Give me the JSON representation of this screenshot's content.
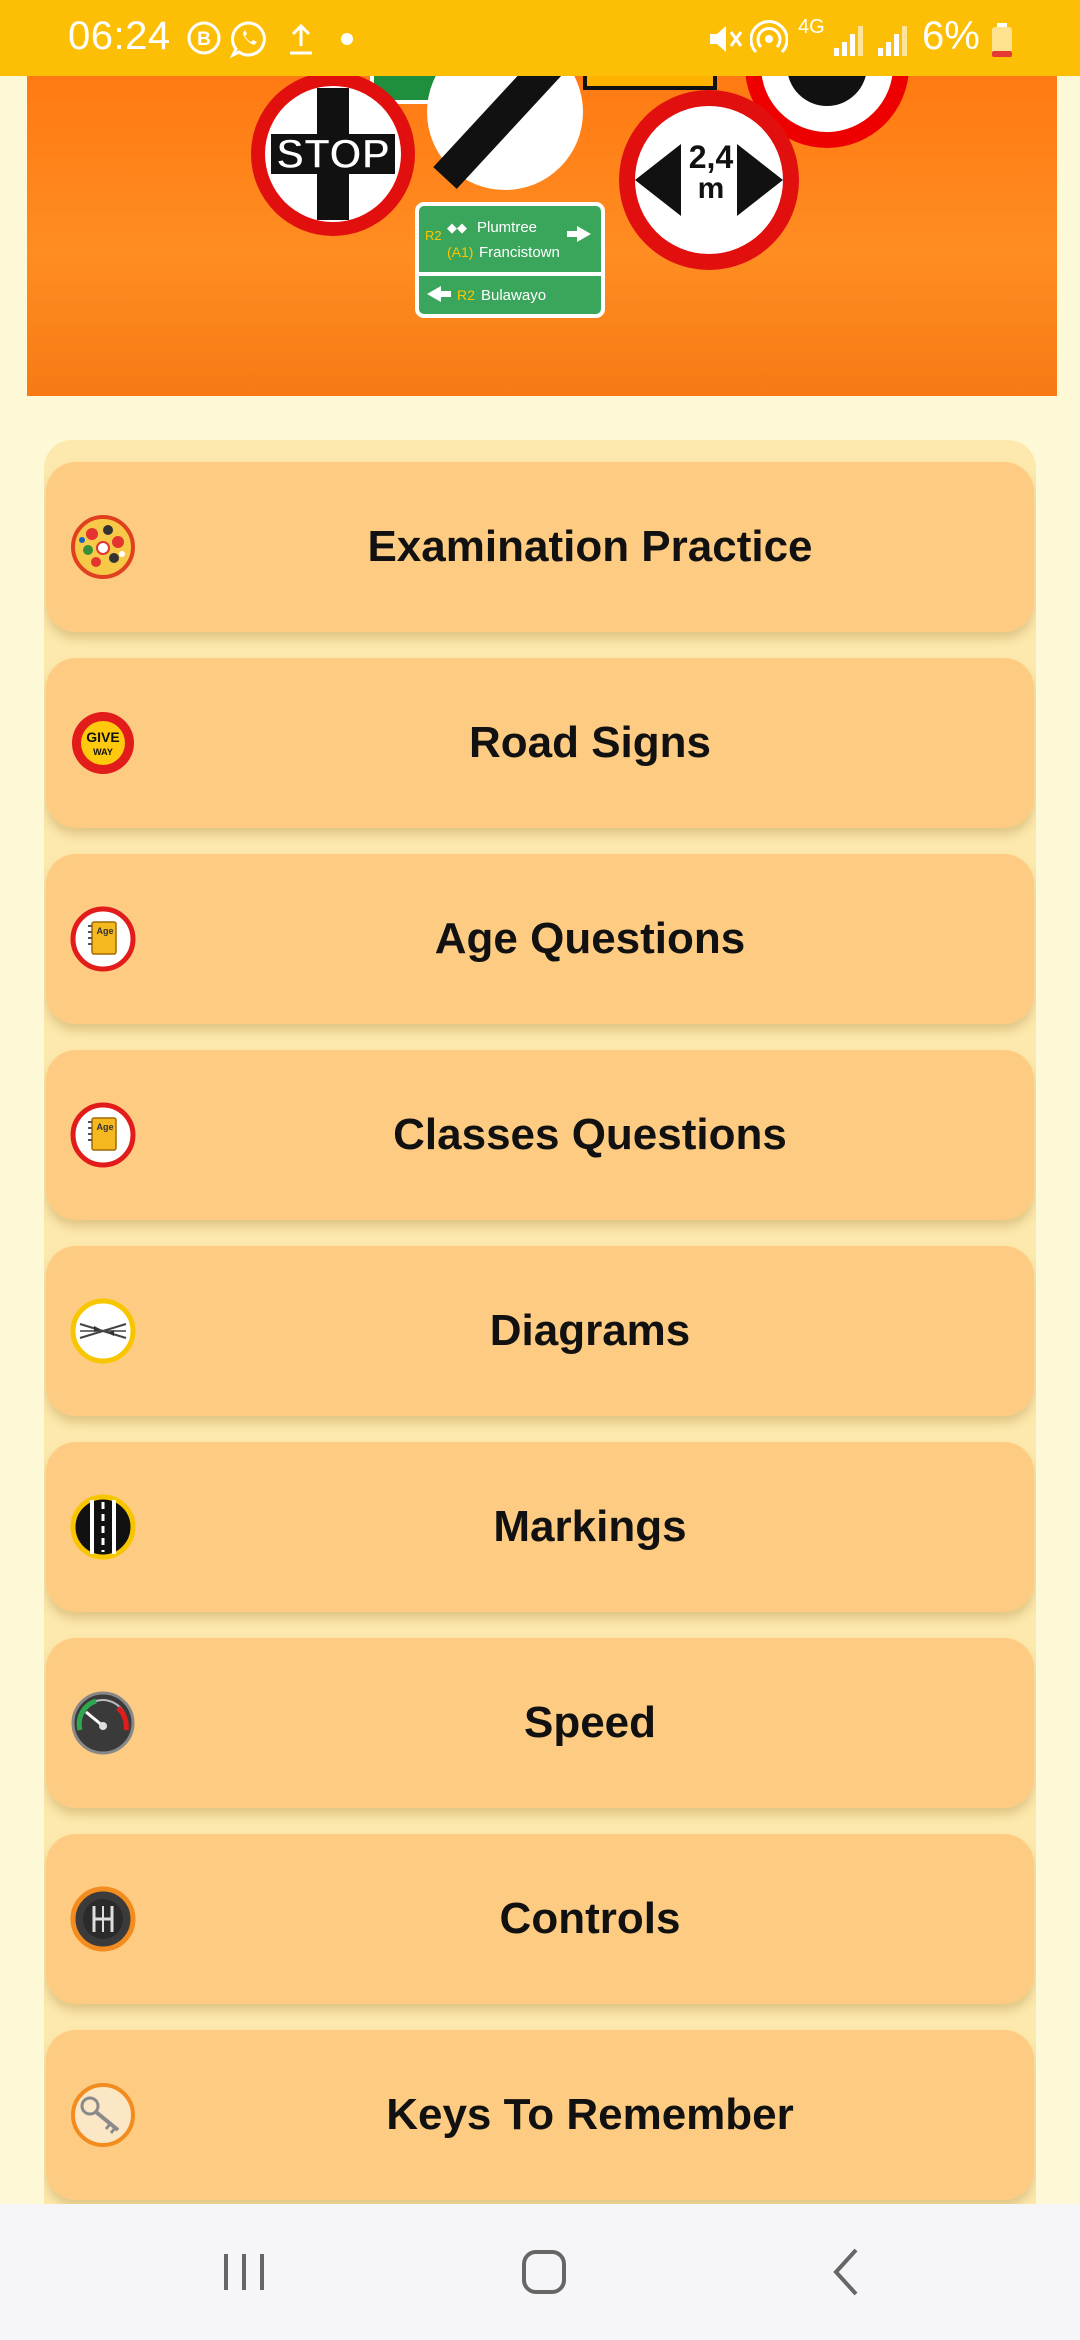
{
  "status_bar": {
    "time": "06:24",
    "battery_text": "6%",
    "network_label": "4G"
  },
  "banner": {
    "stop_sign_text": "STOP",
    "height_sign_line1": "2,4",
    "height_sign_line2": "m",
    "direction_sign": {
      "row1_route": "R2",
      "row1_alt_route": "(A1)",
      "row1_dest1": "Plumtree",
      "row1_dest2": "Francistown",
      "row2_route": "R2",
      "row2_dest": "Bulawayo"
    }
  },
  "menu": {
    "items": [
      {
        "label": "Examination Practice",
        "icon": "examination-practice-icon"
      },
      {
        "label": "Road Signs",
        "icon": "give-way-sign-icon",
        "icon_text_1": "GIVE",
        "icon_text_2": "WAY"
      },
      {
        "label": "Age Questions",
        "icon": "age-notebook-icon",
        "icon_text": "Age"
      },
      {
        "label": "Classes Questions",
        "icon": "age-notebook-icon",
        "icon_text": "Age"
      },
      {
        "label": "Diagrams",
        "icon": "diagram-icon"
      },
      {
        "label": "Markings",
        "icon": "road-marking-icon"
      },
      {
        "label": "Speed",
        "icon": "speedometer-icon"
      },
      {
        "label": "Controls",
        "icon": "gear-shift-icon"
      },
      {
        "label": "Keys To Remember",
        "icon": "key-icon"
      }
    ]
  },
  "colors": {
    "status_bar": "#fcbf06",
    "background": "#fdf8d6",
    "menu_item": "#fdcb81",
    "banner": "#ff7a12"
  }
}
